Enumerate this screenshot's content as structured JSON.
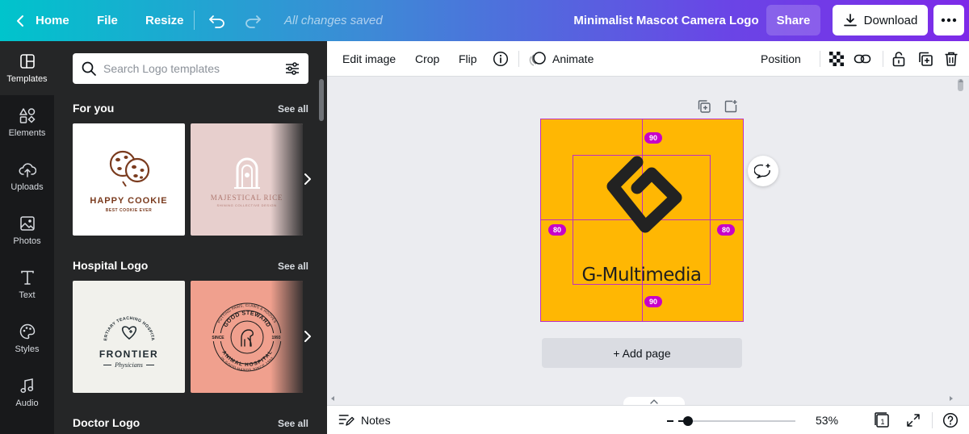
{
  "topbar": {
    "home": "Home",
    "file": "File",
    "resize": "Resize",
    "saved_status": "All changes saved",
    "doc_title": "Minimalist Mascot Camera Logo",
    "share": "Share",
    "download": "Download"
  },
  "rail": {
    "items": [
      {
        "label": "Templates",
        "icon": "templates-icon"
      },
      {
        "label": "Elements",
        "icon": "elements-icon"
      },
      {
        "label": "Uploads",
        "icon": "uploads-icon"
      },
      {
        "label": "Photos",
        "icon": "photos-icon"
      },
      {
        "label": "Text",
        "icon": "text-icon"
      },
      {
        "label": "Styles",
        "icon": "palette-icon"
      },
      {
        "label": "Audio",
        "icon": "music-note-icon"
      }
    ]
  },
  "panel": {
    "search_placeholder": "Search Logo templates",
    "sections": [
      {
        "title": "For you",
        "see_all": "See all",
        "cards": [
          {
            "name": "HAPPY COOKIE",
            "tagline": "BEST COOKIE EVER",
            "bg": "#ffffff",
            "fg": "#7a3b1e"
          },
          {
            "name": "MAJESTICAL RICE",
            "tagline": "SHINING COLLECTIVE DESIGN",
            "bg": "#e7cfcd",
            "fg": "#b07a72"
          }
        ]
      },
      {
        "title": "Hospital Logo",
        "see_all": "See all",
        "cards": [
          {
            "name": "FRONTIER",
            "tagline": "Physicians",
            "arc": "TERTIARY TEACHING HOSPITAL",
            "bg": "#f1f1ec",
            "fg": "#1f2a30"
          },
          {
            "name": "GOOD STEWARD",
            "tagline": "ANIMAL HOSPITAL",
            "since": "SINCE",
            "year": "1993",
            "top_arc": "PUTTING PAWS, CLAWS & HOOVES",
            "bottom_arc": "IN GOOD HANDS SINCE 1993",
            "bg": "#f0a08e",
            "fg": "#1e1e1e"
          }
        ]
      },
      {
        "title": "Doctor Logo",
        "see_all": "See all"
      }
    ]
  },
  "context_toolbar": {
    "edit_image": "Edit image",
    "crop": "Crop",
    "flip": "Flip",
    "animate": "Animate",
    "position": "Position"
  },
  "canvas": {
    "logo_text": "G-Multimedia",
    "artboard_color": "#ffb703",
    "spacing": {
      "top": "90",
      "bottom": "90",
      "left": "80",
      "right": "80"
    },
    "add_page": "+ Add page"
  },
  "bottombar": {
    "notes": "Notes",
    "zoom_percent": "53%",
    "zoom_value": 0.08,
    "page_count": "1"
  },
  "colors": {
    "accent_purple": "#7d2ae8",
    "accent_teal": "#00c4cc",
    "guide_magenta": "#c800c8"
  }
}
